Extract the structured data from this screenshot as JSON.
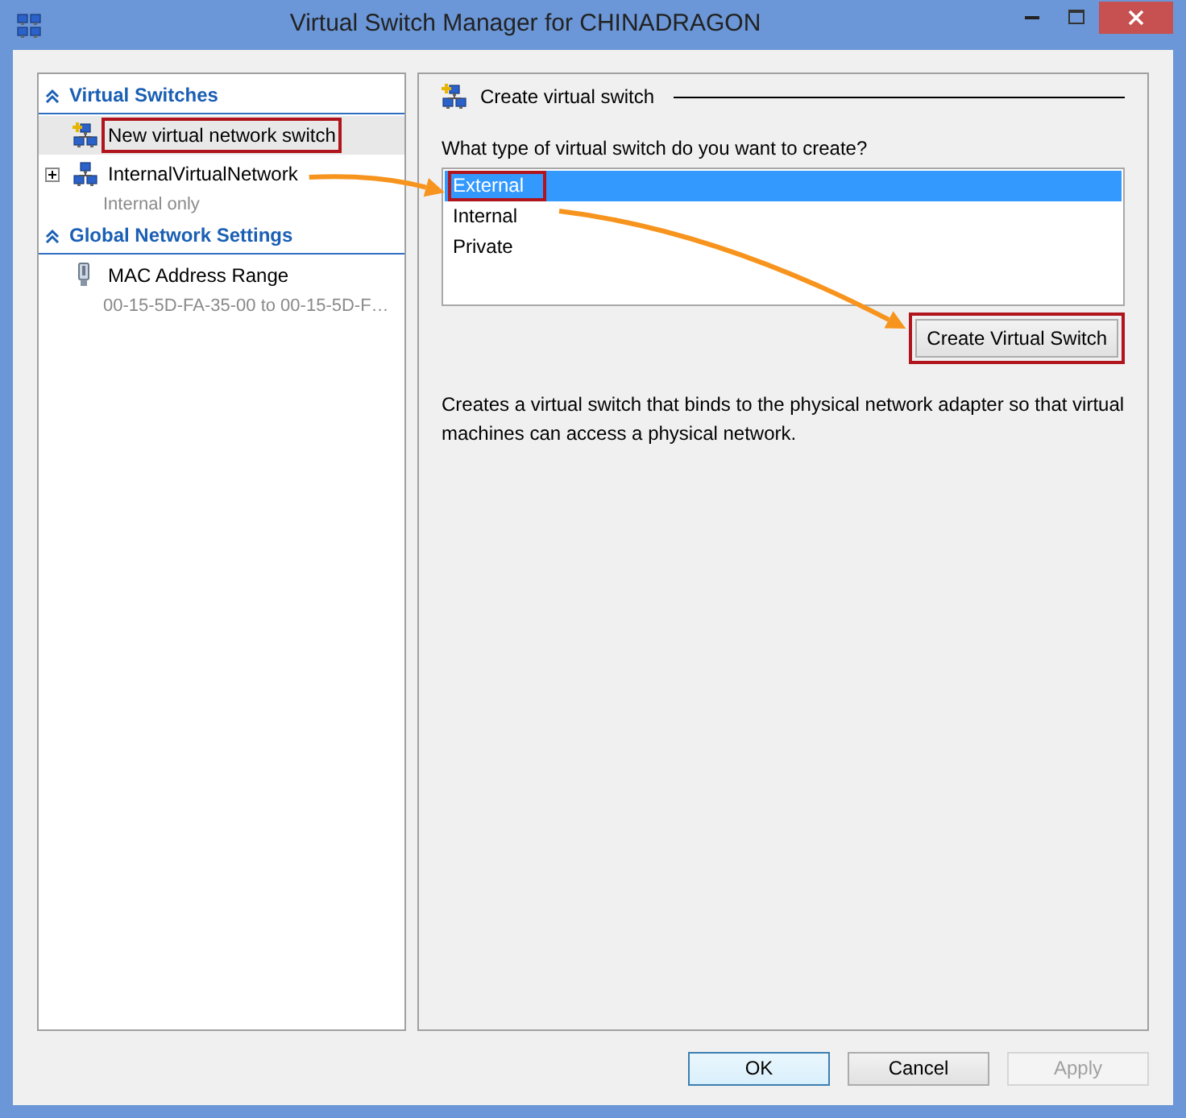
{
  "window": {
    "title": "Virtual Switch Manager for CHINADRAGON"
  },
  "sidebar": {
    "sections": [
      {
        "title": "Virtual Switches",
        "expanded": true,
        "items": [
          {
            "label": "New virtual network switch",
            "kind": "new",
            "selected": true,
            "highlighted": true
          },
          {
            "label": "InternalVirtualNetwork",
            "sublabel": "Internal only",
            "kind": "switch",
            "selected": false,
            "highlighted": false,
            "expanded": false
          }
        ]
      },
      {
        "title": "Global Network Settings",
        "expanded": true,
        "items": [
          {
            "label": "MAC Address Range",
            "sublabel": "00-15-5D-FA-35-00 to 00-15-5D-F…",
            "kind": "mac",
            "selected": false,
            "highlighted": false
          }
        ]
      }
    ]
  },
  "panel": {
    "title": "Create virtual switch",
    "question": "What type of virtual switch do you want to create?",
    "types": [
      {
        "label": "External",
        "selected": true,
        "highlighted": true
      },
      {
        "label": "Internal",
        "selected": false,
        "highlighted": false
      },
      {
        "label": "Private",
        "selected": false,
        "highlighted": false
      }
    ],
    "create_button": {
      "label": "Create Virtual Switch",
      "highlighted": true
    },
    "description": "Creates a virtual switch that binds to the physical network adapter so that virtual machines can access a physical network."
  },
  "buttons": [
    {
      "label": "OK",
      "kind": "default",
      "disabled": false
    },
    {
      "label": "Cancel",
      "kind": "normal",
      "disabled": false
    },
    {
      "label": "Apply",
      "kind": "normal",
      "disabled": true
    }
  ]
}
